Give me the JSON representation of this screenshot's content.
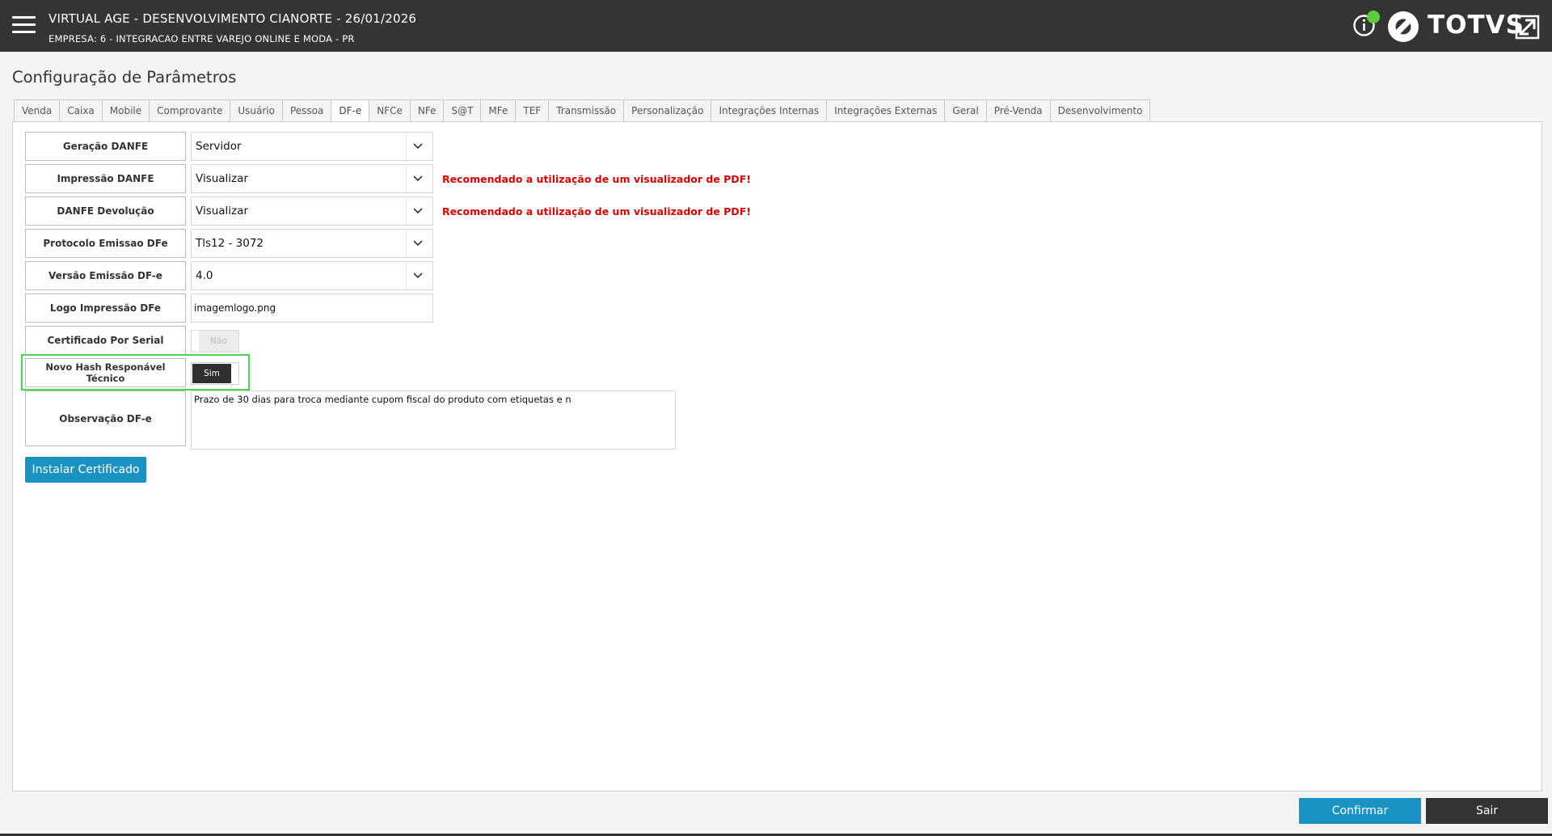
{
  "header": {
    "title": "VIRTUAL AGE - DESENVOLVIMENTO CIANORTE - 26/01/2026",
    "company": "EMPRESA: 6 - INTEGRACAO ENTRE VAREJO ONLINE E MODA - PR",
    "brand": "TOTVS",
    "menu_icon": "hamburger-menu-icon",
    "info_icon": "info-icon",
    "status_color": "#5ccd3b",
    "expand_icon": "expand-window-icon"
  },
  "page": {
    "title": "Configuração de Parâmetros"
  },
  "tabs": [
    {
      "label": "Venda"
    },
    {
      "label": "Caixa"
    },
    {
      "label": "Mobile"
    },
    {
      "label": "Comprovante"
    },
    {
      "label": "Usuário"
    },
    {
      "label": "Pessoa"
    },
    {
      "label": "DF-e",
      "active": true
    },
    {
      "label": "NFCe"
    },
    {
      "label": "NFe"
    },
    {
      "label": "S@T"
    },
    {
      "label": "MFe"
    },
    {
      "label": "TEF"
    },
    {
      "label": "Transmissão"
    },
    {
      "label": "Personalização"
    },
    {
      "label": "Integrações Internas"
    },
    {
      "label": "Integrações Externas"
    },
    {
      "label": "Geral"
    },
    {
      "label": "Pré-Venda"
    },
    {
      "label": "Desenvolvimento"
    }
  ],
  "form": {
    "geracao_danfe": {
      "label": "Geração DANFE",
      "value": "Servidor"
    },
    "impressao_danfe": {
      "label": "Impressão DANFE",
      "value": "Visualizar",
      "warning": "Recomendado a utilização de um visualizador de PDF!"
    },
    "danfe_devolucao": {
      "label": "DANFE Devolução",
      "value": "Visualizar",
      "warning": "Recomendado a utilização de um visualizador de PDF!"
    },
    "protocolo_emissao": {
      "label": "Protocolo Emissao DFe",
      "value": "Tls12 - 3072"
    },
    "versao_emissao": {
      "label": "Versão Emissão DF-e",
      "value": "4.0"
    },
    "logo_impressao": {
      "label": "Logo Impressão DFe",
      "value": "imagemlogo.png"
    },
    "certificado_serial": {
      "label": "Certificado Por Serial",
      "value": "Não"
    },
    "novo_hash": {
      "label": "Novo Hash Responável Técnico",
      "value": "Sim"
    },
    "observacao": {
      "label": "Observação DF-e",
      "value": "Prazo de 30 dias para troca mediante cupom fiscal do produto com etiquetas e n"
    }
  },
  "buttons": {
    "install": "Instalar Certificado",
    "confirm": "Confirmar",
    "exit": "Sair"
  },
  "colors": {
    "topbar": "#343434",
    "primary": "#1b93c2",
    "warning": "#e00000",
    "highlight": "#4cd44c"
  }
}
